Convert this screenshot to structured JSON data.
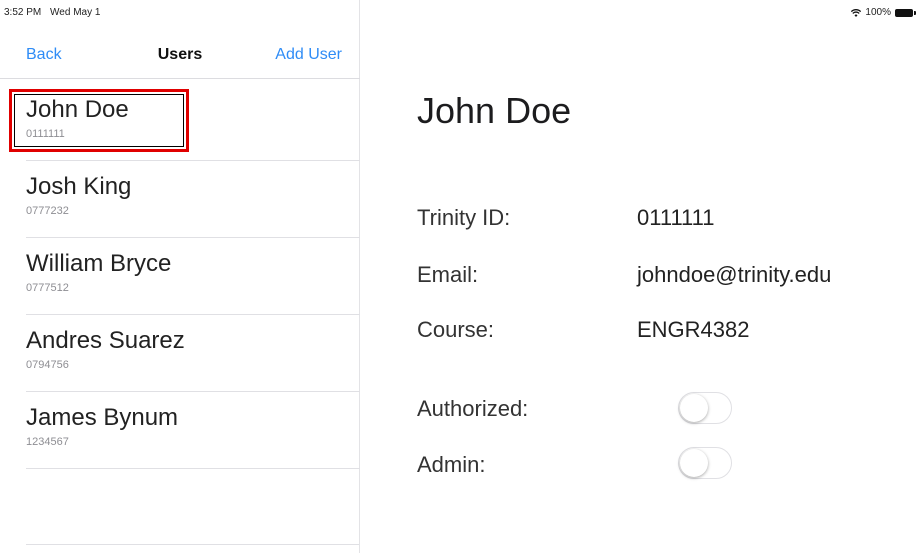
{
  "status_bar": {
    "time": "3:52 PM",
    "date": "Wed May 1",
    "battery": "100%"
  },
  "nav": {
    "back_label": "Back",
    "title": "Users",
    "add_label": "Add User"
  },
  "users": [
    {
      "name": "John Doe",
      "id": "0111111"
    },
    {
      "name": "Josh King",
      "id": "0777232"
    },
    {
      "name": "William Bryce",
      "id": "0777512"
    },
    {
      "name": "Andres Suarez",
      "id": "0794756"
    },
    {
      "name": "James Bynum",
      "id": "1234567"
    }
  ],
  "detail": {
    "title": "John Doe",
    "trinity_id_label": "Trinity ID:",
    "trinity_id_value": "0111111",
    "email_label": "Email:",
    "email_value": "johndoe@trinity.edu",
    "course_label": "Course:",
    "course_value": "ENGR4382",
    "authorized_label": "Authorized:",
    "authorized_on": false,
    "admin_label": "Admin:",
    "admin_on": false
  },
  "colors": {
    "accent": "#2f8cf6",
    "highlight": "#e00000"
  },
  "icons": {
    "wifi": "wifi-icon",
    "battery": "battery-icon"
  }
}
